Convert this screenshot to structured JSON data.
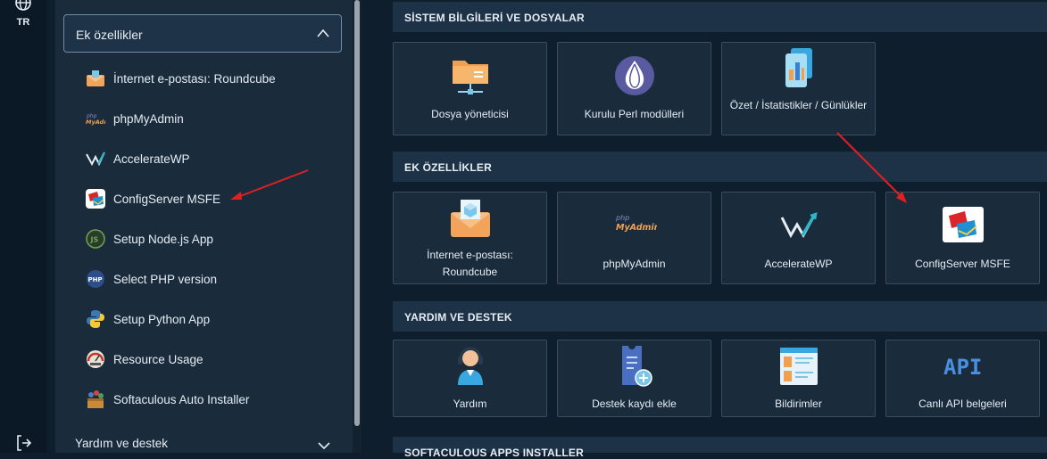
{
  "rail": {
    "lang": "TR"
  },
  "sidebar": {
    "accordion_label": "Ek özellikler",
    "items": [
      {
        "label": "İnternet e-postası: Roundcube",
        "icon": "envelope-icon"
      },
      {
        "label": "phpMyAdmin",
        "icon": "phpmyadmin-icon"
      },
      {
        "label": "AccelerateWP",
        "icon": "acceleratewp-icon"
      },
      {
        "label": "ConfigServer MSFE",
        "icon": "configserver-icon"
      },
      {
        "label": "Setup Node.js App",
        "icon": "nodejs-icon"
      },
      {
        "label": "Select PHP version",
        "icon": "php-icon"
      },
      {
        "label": "Setup Python App",
        "icon": "python-icon"
      },
      {
        "label": "Resource Usage",
        "icon": "gauge-icon"
      },
      {
        "label": "Softaculous Auto Installer",
        "icon": "softaculous-icon"
      }
    ],
    "footer_label": "Yardım ve destek"
  },
  "main": {
    "sections": [
      {
        "title": "SİSTEM BİLGİLERİ VE DOSYALAR",
        "cards": [
          {
            "label": "Dosya yöneticisi",
            "icon": "folder-icon"
          },
          {
            "label": "Kurulu Perl modülleri",
            "icon": "perl-onion-icon"
          },
          {
            "label": "Özet / İstatistikler / Günlükler",
            "icon": "stats-icon"
          }
        ]
      },
      {
        "title": "EK ÖZELLİKLER",
        "cards": [
          {
            "label": "İnternet e-postası: Roundcube",
            "icon": "envelope-icon"
          },
          {
            "label": "phpMyAdmin",
            "icon": "phpmyadmin-icon"
          },
          {
            "label": "AccelerateWP",
            "icon": "acceleratewp-icon"
          },
          {
            "label": "ConfigServer MSFE",
            "icon": "configserver-icon"
          }
        ]
      },
      {
        "title": "YARDIM VE DESTEK",
        "cards": [
          {
            "label": "Yardım",
            "icon": "support-agent-icon"
          },
          {
            "label": "Destek kaydı ekle",
            "icon": "ticket-add-icon"
          },
          {
            "label": "Bildirimler",
            "icon": "notifications-icon"
          },
          {
            "label": "Canlı API belgeleri",
            "icon": "api-icon"
          }
        ]
      },
      {
        "title": "SOFTACULOUS APPS INSTALLER",
        "cards": []
      }
    ],
    "icon_text": {
      "php_small": "php",
      "myadmin": "MyAdmin",
      "api": "API",
      "js": "JS",
      "php": "PHP"
    }
  },
  "colors": {
    "arrow": "#e02020",
    "accent_orange": "#f0a050",
    "perl_purple": "#5a5aa0"
  }
}
